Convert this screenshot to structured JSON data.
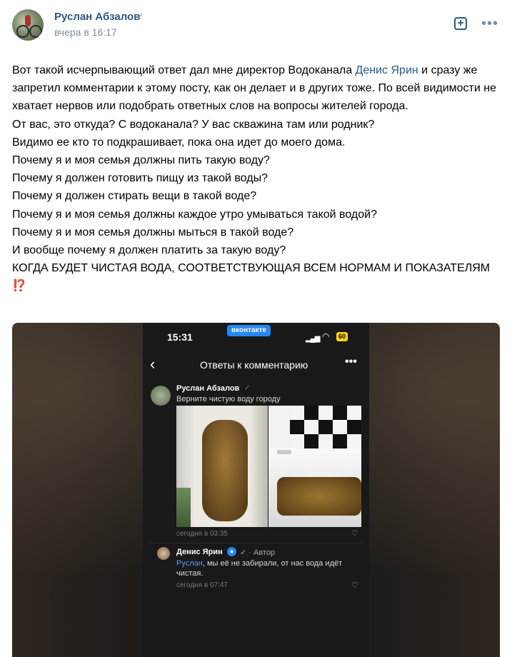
{
  "post": {
    "author": "Руслан Абзалов",
    "verified_mark": "✓",
    "timestamp": "вчера в 16:17",
    "add_icon": "+",
    "more_icon": "•••",
    "text_intro_before": "Вот такой исчерпывающий ответ дал мне директор Водоканала ",
    "mention": "Денис Ярин",
    "text_intro_after": " и сразу же запретил комментарии к этому посту, как он делает и в других тоже. По всей видимости не хватает нервов или подобрать ответных слов на вопросы жителей города.",
    "lines": [
      "От вас, это откуда? С водоканала? У вас скважина там или родник?",
      "Видимо ее кто то подкрашивает, пока она идет до моего дома.",
      "Почему я и моя семья должны пить такую воду?",
      "Почему я должен готовить пищу из такой воды?",
      "Почему я должен стирать вещи в такой воде?",
      "Почему я и моя семья должны каждое утро умываться такой водой?",
      "Почему я и моя семья должны мыться в такой воде?",
      "И вообще почему я должен платить за такую воду?",
      "КОГДА БУДЕТ ЧИСТАЯ ВОДА, СООТВЕТСТВУЮЩАЯ ВСЕМ НОРМАМ И ПОКАЗАТЕЛЯМ"
    ],
    "emoji": "⁉️"
  },
  "screenshot": {
    "status_time": "15:31",
    "app_badge": "вконтакте",
    "battery": "60",
    "nav_back": "‹",
    "nav_title": "Ответы к комментарию",
    "nav_more": "•••",
    "comment1": {
      "author": "Руслан Абзалов",
      "check": "✓",
      "text": "Верните чистую воду городу",
      "date": "сегодня в 03:35",
      "heart": "♡"
    },
    "comment2": {
      "author": "Денис Ярин",
      "author_tag": "✓ · Автор",
      "mention": "Руслан",
      "text": ", мы её не забирали, от нас вода идёт чистая.",
      "date": "сегодня в 07:47",
      "heart": "♡"
    }
  }
}
